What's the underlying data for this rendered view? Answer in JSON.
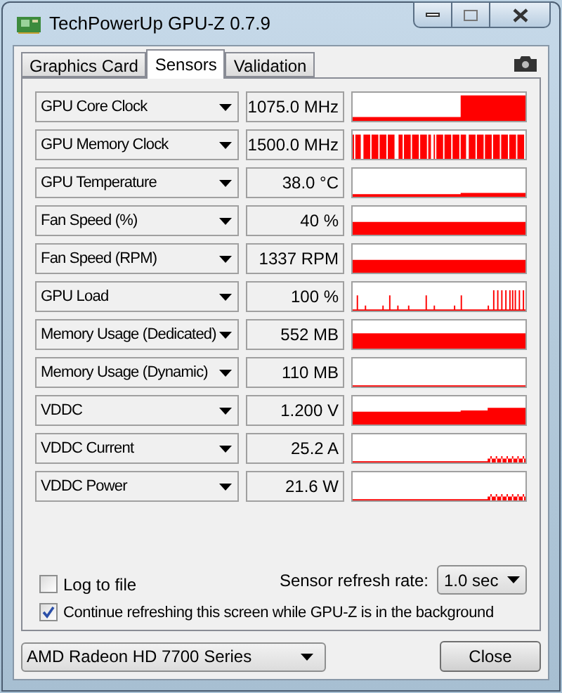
{
  "window": {
    "title": "TechPowerUp GPU-Z 0.7.9"
  },
  "tabs": [
    {
      "label": "Graphics Card",
      "selected": false
    },
    {
      "label": "Sensors",
      "selected": true
    },
    {
      "label": "Validation",
      "selected": false
    }
  ],
  "sensors": [
    {
      "name": "GPU Core Clock",
      "value": "1075.0 MHz"
    },
    {
      "name": "GPU Memory Clock",
      "value": "1500.0 MHz"
    },
    {
      "name": "GPU Temperature",
      "value": "38.0 °C"
    },
    {
      "name": "Fan Speed (%)",
      "value": "40 %"
    },
    {
      "name": "Fan Speed (RPM)",
      "value": "1337 RPM"
    },
    {
      "name": "GPU Load",
      "value": "100 %"
    },
    {
      "name": "Memory Usage (Dedicated)",
      "value": "552 MB"
    },
    {
      "name": "Memory Usage (Dynamic)",
      "value": "110 MB"
    },
    {
      "name": "VDDC",
      "value": "1.200 V"
    },
    {
      "name": "VDDC Current",
      "value": "25.2 A"
    },
    {
      "name": "VDDC Power",
      "value": "21.6 W"
    }
  ],
  "log_to_file": {
    "label": "Log to file",
    "checked": false
  },
  "refresh_rate": {
    "label": "Sensor refresh rate:",
    "value": "1.0 sec"
  },
  "background_refresh": {
    "label": "Continue refreshing this screen while GPU-Z is in the background",
    "checked": true
  },
  "gpu_select": {
    "value": "AMD Radeon HD 7700 Series"
  },
  "close_button": "Close"
}
